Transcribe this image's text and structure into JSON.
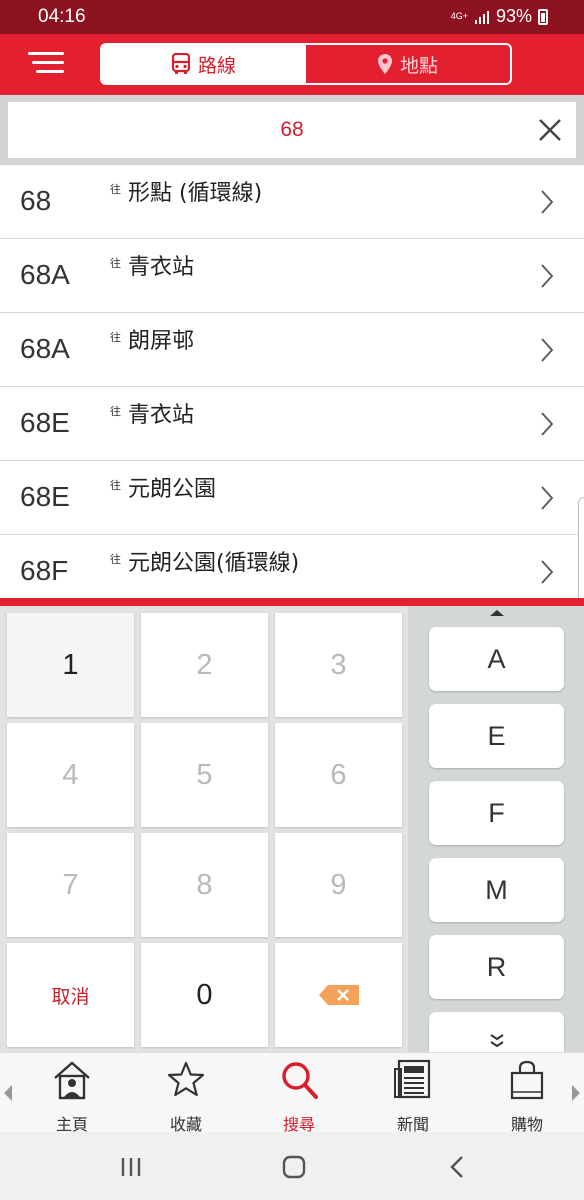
{
  "status_bar": {
    "time": "04:16",
    "network": "4G+",
    "battery": "93%"
  },
  "header": {
    "tabs": [
      {
        "label": "路線",
        "icon": "bus-icon",
        "active": true
      },
      {
        "label": "地點",
        "icon": "location-pin-icon",
        "active": false
      }
    ]
  },
  "search": {
    "value": "68"
  },
  "routes": [
    {
      "number": "68",
      "prefix": "往",
      "destination": "形點 (循環線)"
    },
    {
      "number": "68A",
      "prefix": "往",
      "destination": "青衣站"
    },
    {
      "number": "68A",
      "prefix": "往",
      "destination": "朗屏邨"
    },
    {
      "number": "68E",
      "prefix": "往",
      "destination": "青衣站"
    },
    {
      "number": "68E",
      "prefix": "往",
      "destination": "元朗公園"
    },
    {
      "number": "68F",
      "prefix": "往",
      "destination": "元朗公園(循環線)"
    }
  ],
  "keypad": {
    "digits": [
      "1",
      "2",
      "3",
      "4",
      "5",
      "6",
      "7",
      "8",
      "9"
    ],
    "enabled_digits": [
      "1",
      "0"
    ],
    "cancel": "取消",
    "zero": "0",
    "letters": [
      "A",
      "E",
      "F",
      "M",
      "R"
    ]
  },
  "bottom_nav": [
    {
      "label": "主頁",
      "icon": "home-user-icon"
    },
    {
      "label": "收藏",
      "icon": "star-icon"
    },
    {
      "label": "搜尋",
      "icon": "search-icon",
      "active": true
    },
    {
      "label": "新聞",
      "icon": "newspaper-icon"
    },
    {
      "label": "購物",
      "icon": "shopping-bag-icon"
    }
  ],
  "colors": {
    "brand_red": "#e3202f",
    "status_bar": "#8d1220",
    "accent_text": "#cc1f2d"
  }
}
